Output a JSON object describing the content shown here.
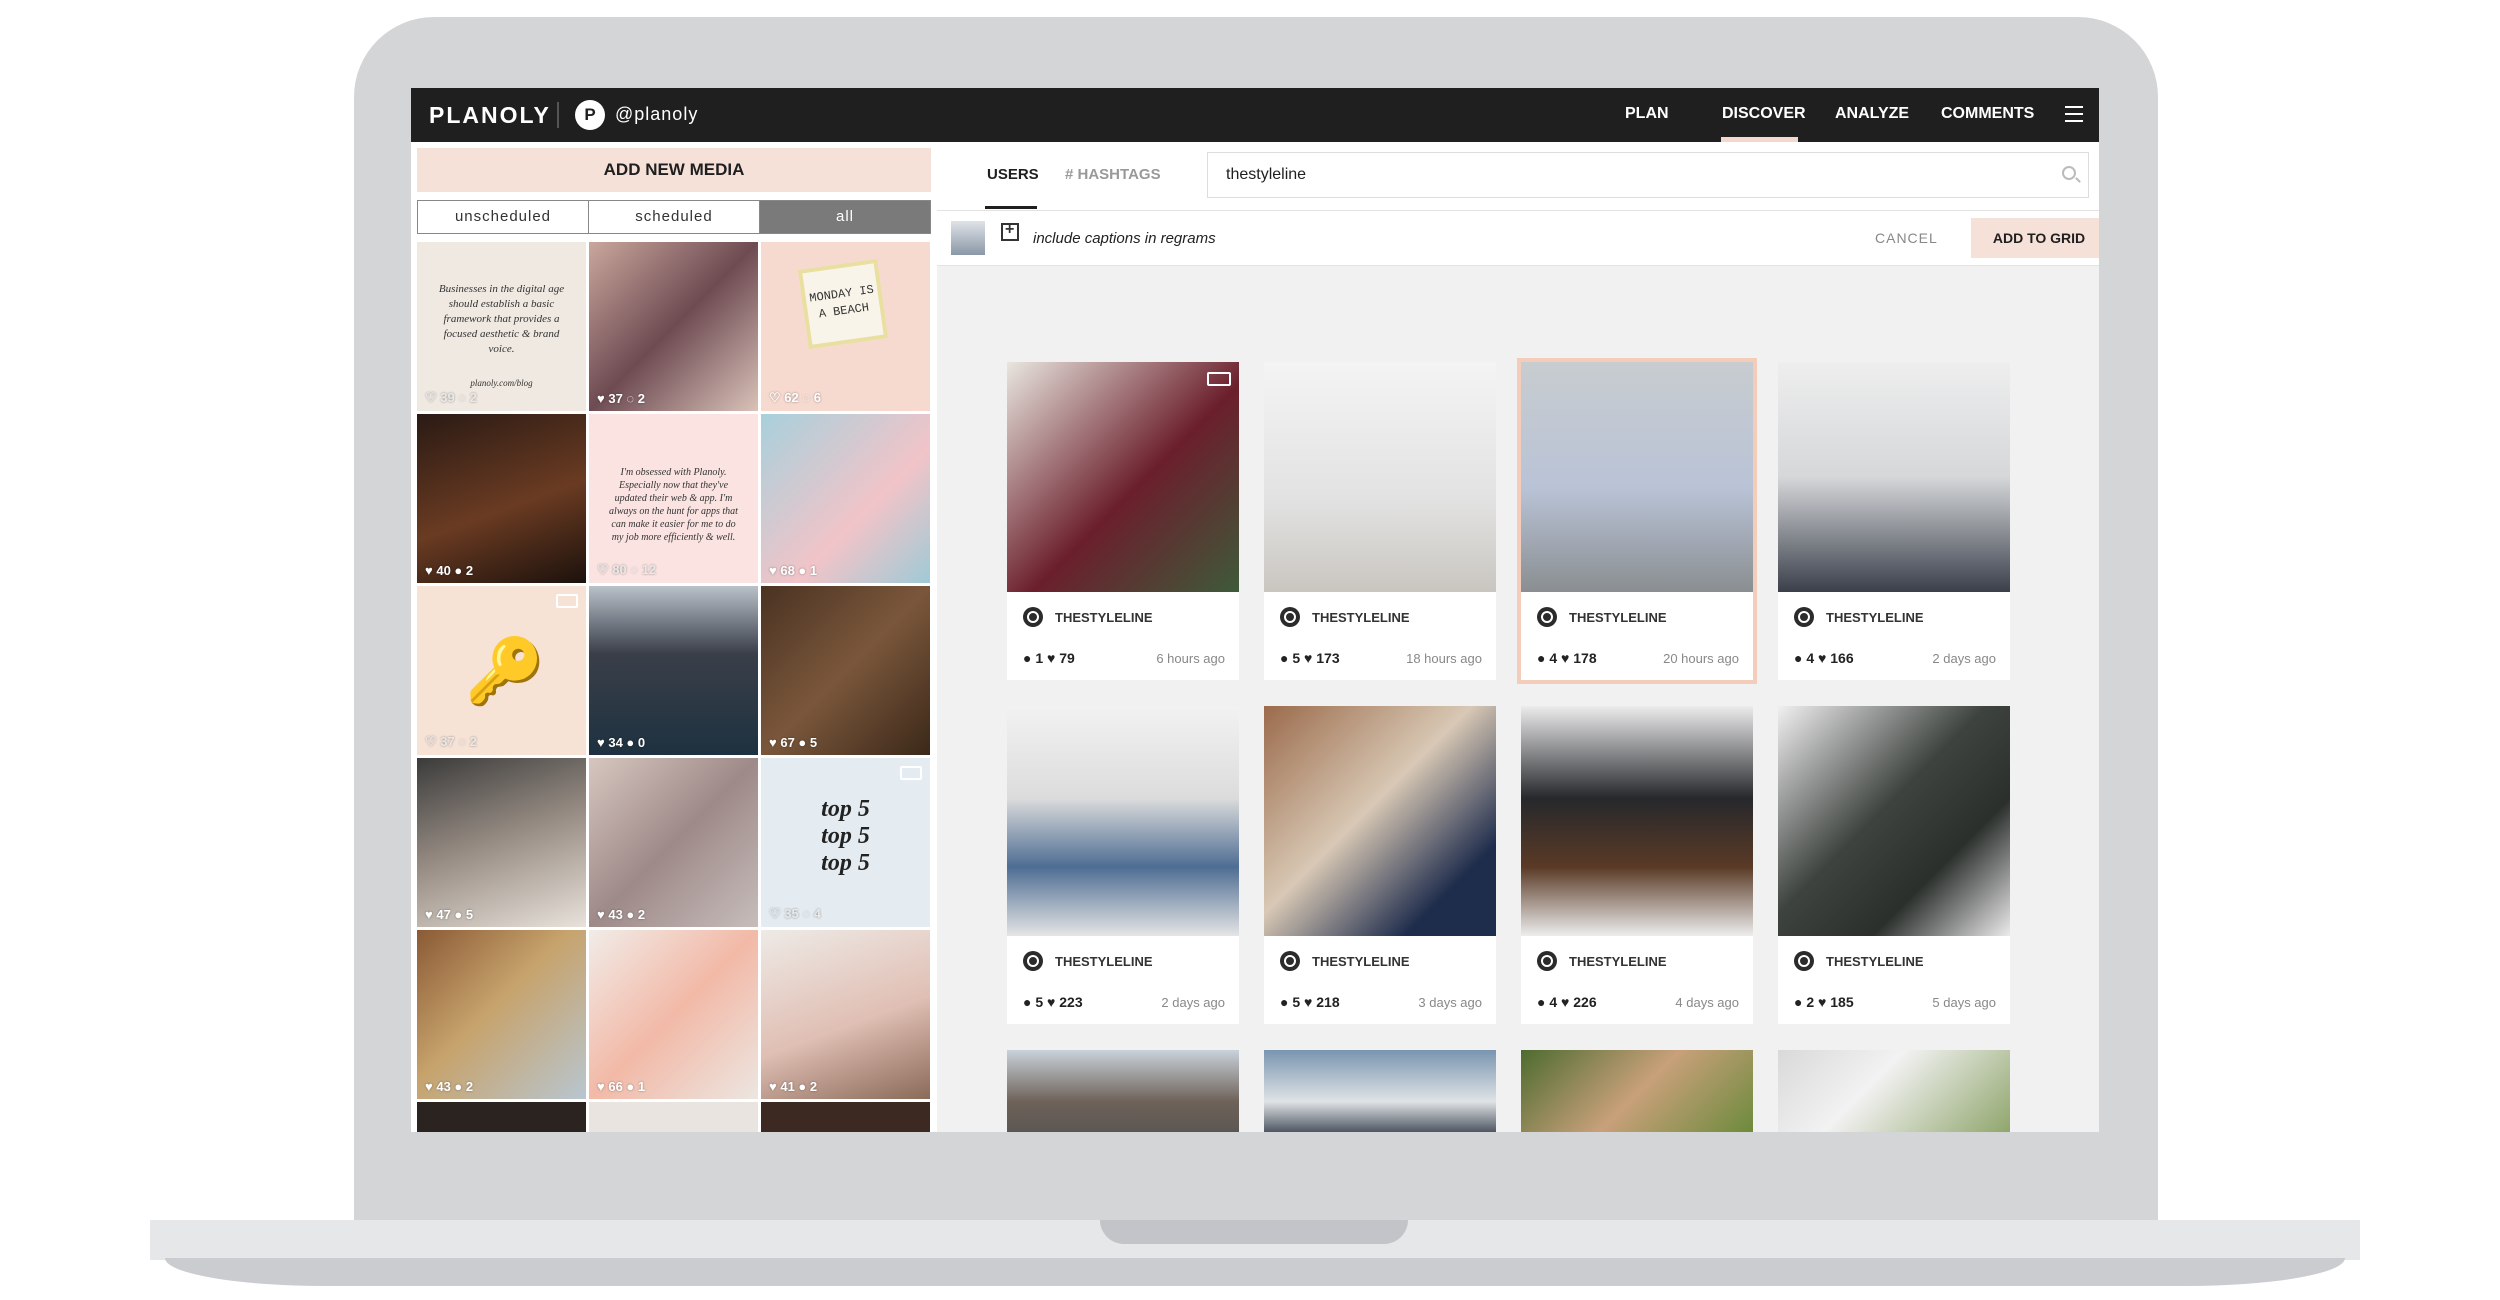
{
  "topbar": {
    "logo": "PLANOLY",
    "avatar_letter": "P",
    "handle": "@planoly",
    "nav": [
      "PLAN",
      "DISCOVER",
      "ANALYZE",
      "COMMENTS"
    ],
    "active_nav": "DISCOVER"
  },
  "left_panel": {
    "add_media_label": "ADD NEW MEDIA",
    "filter_tabs": [
      "unscheduled",
      "scheduled",
      "all"
    ],
    "active_filter": "all",
    "tiles": [
      {
        "likes": "39",
        "comments": "2",
        "quote": "Businesses in the digital age should establish a basic framework that provides a focused aesthetic & brand voice.",
        "footer": "planoly.com/blog"
      },
      {
        "likes": "37",
        "comments": "2"
      },
      {
        "likes": "62",
        "comments": "6",
        "card_text": "MONDAY IS A BEACH"
      },
      {
        "likes": "40",
        "comments": "2"
      },
      {
        "likes": "80",
        "comments": "12",
        "quote": "I'm obsessed with Planoly. Especially now that they've updated their web & app. I'm always on the hunt for apps that can make it easier for me to do my job more efficiently & well."
      },
      {
        "likes": "68",
        "comments": "1"
      },
      {
        "likes": "37",
        "comments": "2"
      },
      {
        "likes": "34",
        "comments": "0"
      },
      {
        "likes": "67",
        "comments": "5"
      },
      {
        "likes": "47",
        "comments": "5"
      },
      {
        "likes": "43",
        "comments": "2"
      },
      {
        "likes": "35",
        "comments": "4",
        "big_text": [
          "top 5",
          "top 5",
          "top 5"
        ]
      },
      {
        "likes": "43",
        "comments": "2"
      },
      {
        "likes": "66",
        "comments": "1"
      },
      {
        "likes": "41",
        "comments": "2"
      }
    ]
  },
  "discover": {
    "tabs": [
      "USERS",
      "HASHTAGS"
    ],
    "active_tab": "USERS",
    "search_value": "thestyleline",
    "include_captions_label": "include captions in regrams",
    "cancel_label": "CANCEL",
    "add_to_grid_label": "ADD TO GRID",
    "posts": [
      {
        "user": "THESTYLELINE",
        "comments": "1",
        "likes": "79",
        "time": "6 hours ago"
      },
      {
        "user": "THESTYLELINE",
        "comments": "5",
        "likes": "173",
        "time": "18 hours ago"
      },
      {
        "user": "THESTYLELINE",
        "comments": "4",
        "likes": "178",
        "time": "20 hours ago"
      },
      {
        "user": "THESTYLELINE",
        "comments": "4",
        "likes": "166",
        "time": "2 days ago"
      },
      {
        "user": "THESTYLELINE",
        "comments": "5",
        "likes": "223",
        "time": "2 days ago"
      },
      {
        "user": "THESTYLELINE",
        "comments": "5",
        "likes": "218",
        "time": "3 days ago"
      },
      {
        "user": "THESTYLELINE",
        "comments": "4",
        "likes": "226",
        "time": "4 days ago"
      },
      {
        "user": "THESTYLELINE",
        "comments": "2",
        "likes": "185",
        "time": "5 days ago"
      }
    ]
  }
}
